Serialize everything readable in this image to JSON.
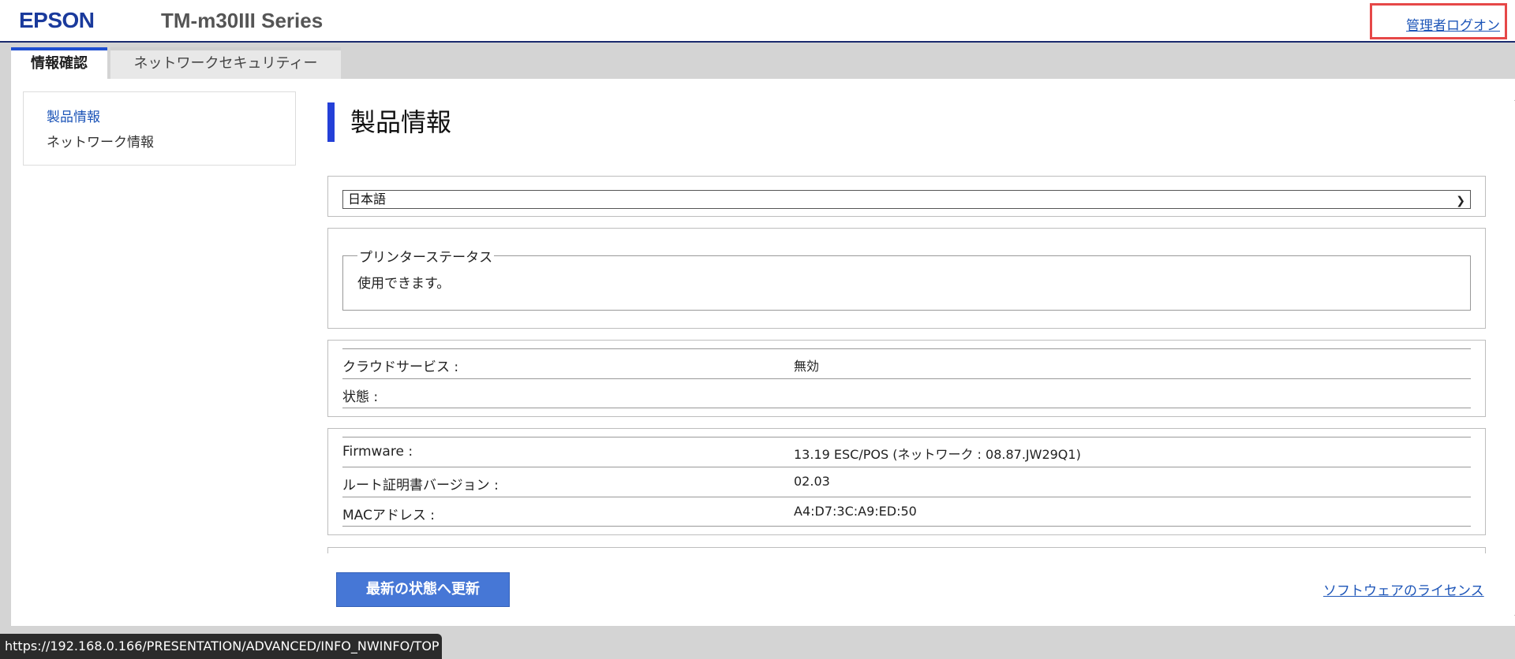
{
  "header": {
    "logo": "EPSON",
    "product": "TM-m30III Series",
    "admin_login": "管理者ログオン"
  },
  "tabs": [
    {
      "label": "情報確認",
      "active": true
    },
    {
      "label": "ネットワークセキュリティー",
      "active": false
    }
  ],
  "sidebar": {
    "items": [
      {
        "label": "製品情報",
        "active": true
      },
      {
        "label": "ネットワーク情報",
        "active": false
      }
    ]
  },
  "main": {
    "heading": "製品情報",
    "language": {
      "selected": "日本語"
    },
    "printer_status": {
      "legend": "プリンターステータス",
      "text": "使用できます。"
    },
    "cloud": [
      {
        "label": "クラウドサービス :",
        "value": "無効"
      },
      {
        "label": "状態 :",
        "value": ""
      }
    ],
    "device": [
      {
        "label": "Firmware :",
        "value": "13.19 ESC/POS (ネットワーク : 08.87.JW29Q1)"
      },
      {
        "label": "ルート証明書バージョン :",
        "value": "02.03"
      },
      {
        "label": "MACアドレス :",
        "value": "A4:D7:3C:A9:ED:50"
      }
    ],
    "refresh_button": "最新の状態へ更新",
    "license_link": "ソフトウェアのライセンス"
  },
  "statusbar": {
    "url": "https://192.168.0.166/PRESENTATION/ADVANCED/INFO_NWINFO/TOP"
  },
  "colors": {
    "brand": "#1a3a9c",
    "accent": "#2440d8",
    "button": "#4677d6",
    "link": "#1d55b8",
    "highlight_box": "#e64848"
  }
}
